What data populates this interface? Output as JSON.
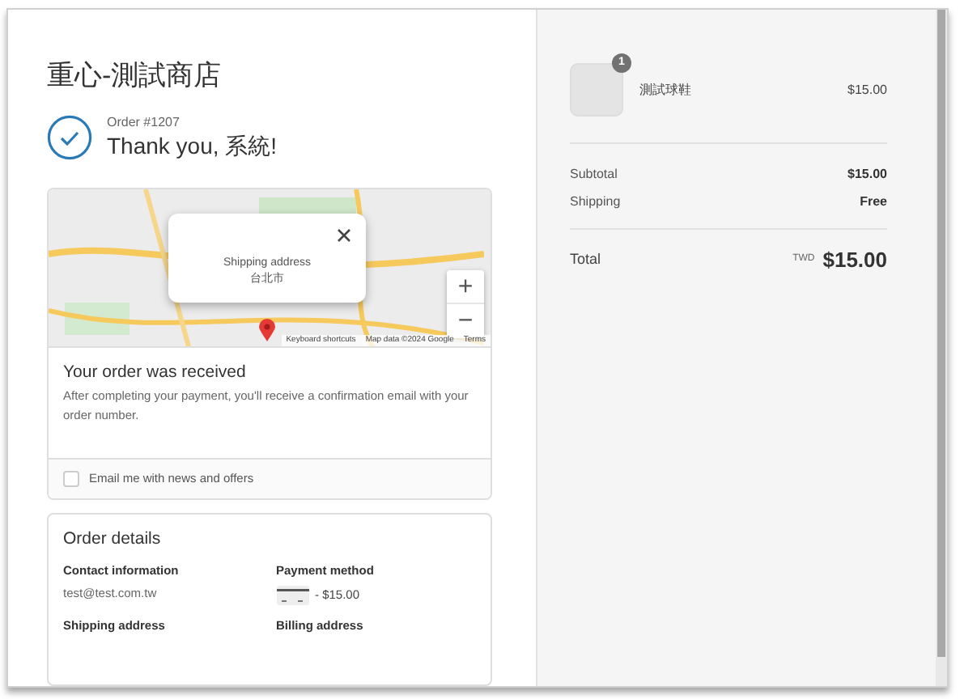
{
  "store": {
    "name": "重心-測試商店"
  },
  "confirmation": {
    "order_number": "Order #1207",
    "thank_you": "Thank you, 系統!"
  },
  "map": {
    "popup": {
      "title": "Shipping address",
      "address": "台北市"
    },
    "zoom_in": "+",
    "zoom_out": "−",
    "attribution": [
      "Keyboard shortcuts",
      "Map data ©2024 Google",
      "Terms"
    ]
  },
  "order_status": {
    "title": "Your order was received",
    "message": "After completing your payment, you'll receive a confirmation email with your order number.",
    "email_optin": {
      "label": "Email me with news and offers",
      "checked": false
    }
  },
  "order_details": {
    "title": "Order details",
    "sections": [
      {
        "heading": "Contact information",
        "value": "test@test.com.tw",
        "kind": "text"
      },
      {
        "heading": "Payment method",
        "value": "- $15.00",
        "kind": "payment"
      },
      {
        "heading": "Shipping address",
        "kind": "heading"
      },
      {
        "heading": "Billing address",
        "kind": "heading"
      }
    ]
  },
  "cart": {
    "items": [
      {
        "name": "測試球鞋",
        "price": "$15.00",
        "quantity": "1"
      }
    ],
    "summary": [
      {
        "label": "Subtotal",
        "value": "$15.00"
      },
      {
        "label": "Shipping",
        "value": "Free"
      }
    ],
    "total": {
      "label": "Total",
      "currency": "TWD",
      "value": "$15.00"
    }
  }
}
